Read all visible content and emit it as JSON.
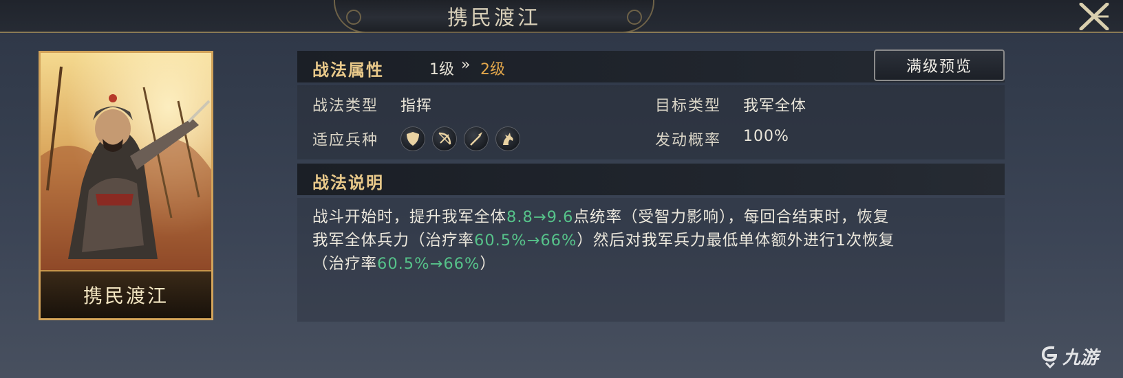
{
  "window": {
    "title": "携民渡江"
  },
  "card": {
    "name": "携民渡江"
  },
  "attributes": {
    "header": "战法属性",
    "level_from": "1级",
    "level_arrow": "»",
    "level_to": "2级",
    "preview_button": "满级预览",
    "type_label": "战法类型",
    "type_value": "指挥",
    "target_label": "目标类型",
    "target_value": "我军全体",
    "troops_label": "适应兵种",
    "troop_icons": [
      "shield-icon",
      "bow-icon",
      "spear-icon",
      "horse-icon"
    ],
    "chance_label": "发动概率",
    "chance_value": "100%"
  },
  "description": {
    "header": "战法说明",
    "line1": [
      "战斗开始时，提升我军全体",
      "8.8→9.6",
      "点统率（受智力影响），每回合结束时，恢复"
    ],
    "line2": [
      "我军全体兵力（治疗率",
      "60.5%→66%",
      "）然后对我军兵力最低单体额外进行1次恢复"
    ],
    "line3": [
      "（治疗率",
      "60.5%→66%",
      "）"
    ]
  },
  "colors": {
    "accent_gold": "#e9c98a",
    "level_orange": "#e3a74b",
    "value_green": "#56c28a"
  },
  "watermark": {
    "text": "九游"
  }
}
